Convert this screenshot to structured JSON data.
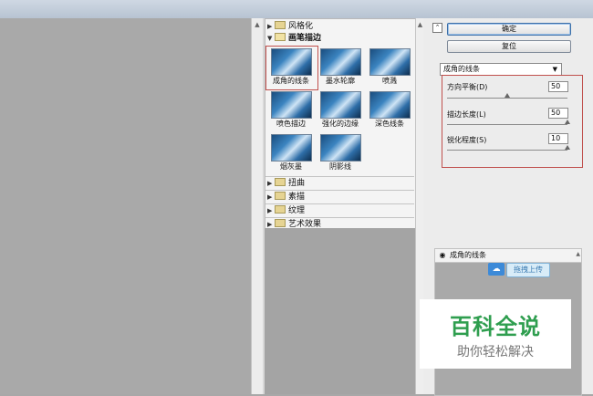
{
  "gallery": {
    "categories_top": [
      {
        "label": "风格化",
        "expanded": false
      },
      {
        "label": "画笔描边",
        "expanded": true
      }
    ],
    "thumbnails": [
      {
        "label": "成角的线条",
        "selected": true
      },
      {
        "label": "墨水轮廓",
        "selected": false
      },
      {
        "label": "喷溅",
        "selected": false
      },
      {
        "label": "喷色描边",
        "selected": false
      },
      {
        "label": "强化的边缘",
        "selected": false
      },
      {
        "label": "深色线条",
        "selected": false
      },
      {
        "label": "烟灰墨",
        "selected": false
      },
      {
        "label": "阴影线",
        "selected": false
      }
    ],
    "categories_bottom": [
      {
        "label": "扭曲"
      },
      {
        "label": "素描"
      },
      {
        "label": "纹理"
      },
      {
        "label": "艺术效果"
      }
    ]
  },
  "buttons": {
    "ok_label": "确定",
    "reset_label": "复位"
  },
  "filter_select": {
    "value": "成角的线条"
  },
  "settings": {
    "params": [
      {
        "label": "方向平衡(D)",
        "value": "50",
        "fraction": 0.5
      },
      {
        "label": "描边长度(L)",
        "value": "50",
        "fraction": 1.0
      },
      {
        "label": "锐化程度(S)",
        "value": "10",
        "fraction": 1.0
      }
    ]
  },
  "layers": {
    "layer_name": "成角的线条",
    "upload_label": "拖拽上传"
  },
  "watermark": {
    "main": "百科全说",
    "sub": "助你轻松解决"
  },
  "icons": {
    "expanded_arrow": "triangle-down",
    "collapsed_arrow": "triangle-right",
    "folder": "folder-icon",
    "collapse": "double-chevron-up-icon",
    "eye": "eye-icon",
    "cloud": "cloud-upload-icon"
  }
}
